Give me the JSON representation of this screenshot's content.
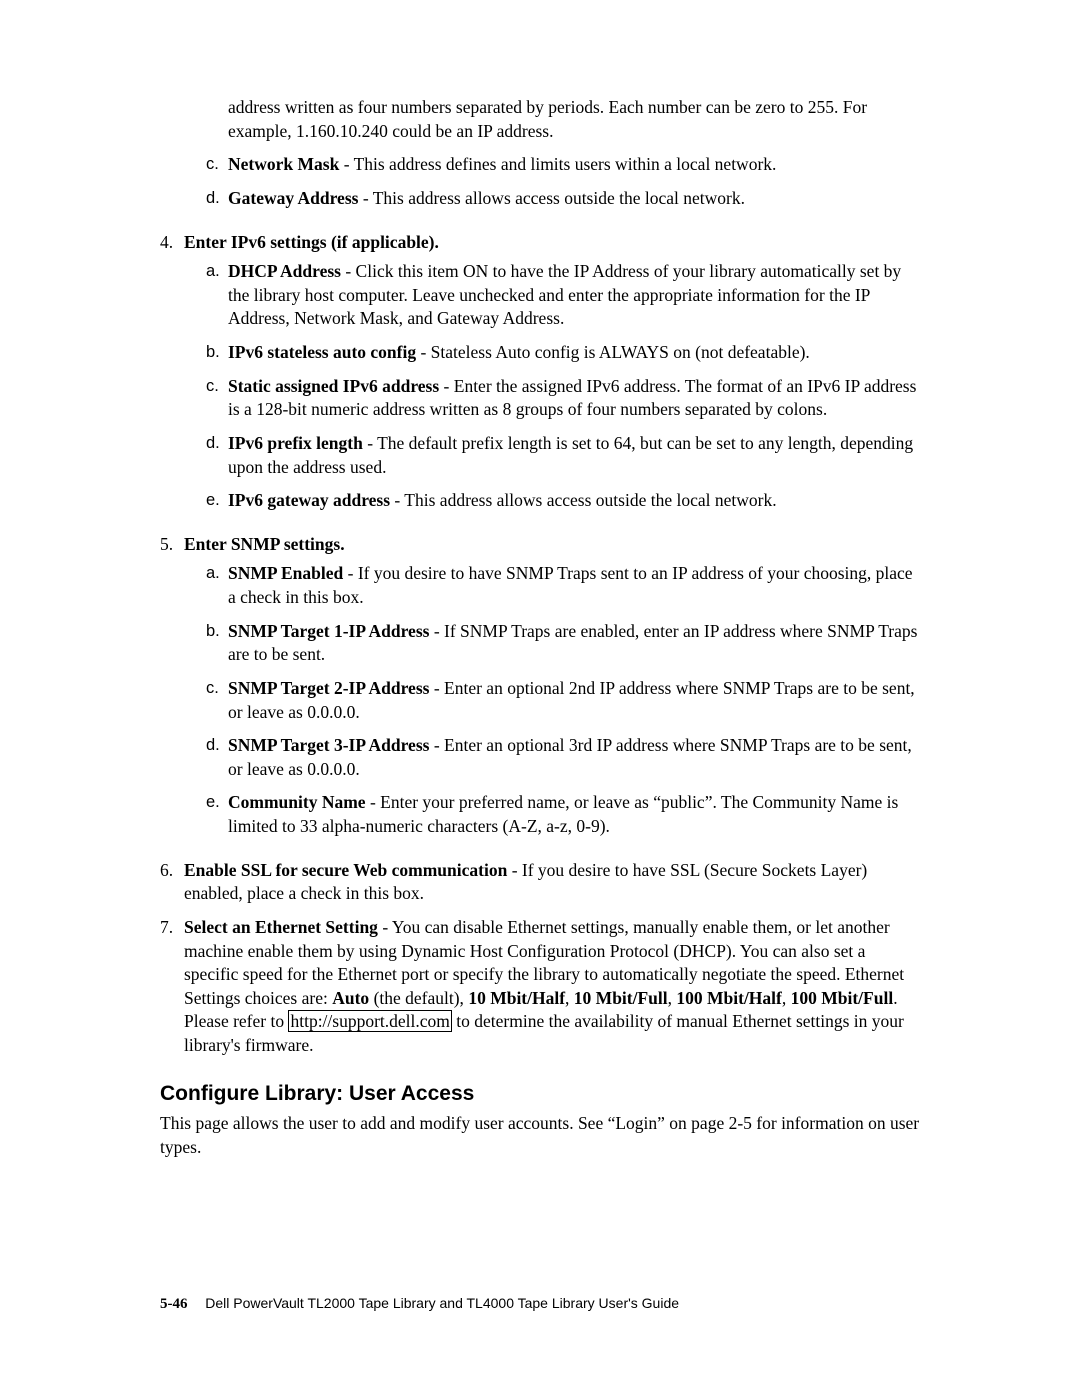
{
  "intro_continuation": {
    "text_prefix": "address written as four numbers separated by periods. Each number can be zero to 255. For example, 1.160.10.240 could be an IP address."
  },
  "items_top": [
    {
      "marker": "c.",
      "label": "Network Mask",
      "text": " - This address defines and limits users within a local network."
    },
    {
      "marker": "d.",
      "label": "Gateway Address",
      "text": " - This address allows access outside the local network."
    }
  ],
  "step4": {
    "marker": "4.",
    "heading": "Enter IPv6 settings (if applicable).",
    "subs": [
      {
        "marker": "a.",
        "label": "DHCP Address",
        "text": " - Click this item ON to have the IP Address of your library automatically set by the library host computer. Leave unchecked and enter the appropriate information for the IP Address, Network Mask, and Gateway Address."
      },
      {
        "marker": "b.",
        "label": "IPv6 stateless auto config",
        "text": " - Stateless Auto config is ALWAYS on (not defeatable)."
      },
      {
        "marker": "c.",
        "label": "Static assigned IPv6 address",
        "text": " - Enter the assigned IPv6 address. The format of an IPv6 IP address is a 128-bit numeric address written as 8 groups of four numbers separated by colons."
      },
      {
        "marker": "d.",
        "label": "IPv6 prefix length",
        "text": " - The default prefix length is set to 64, but can be set to any length, depending upon the address used."
      },
      {
        "marker": "e.",
        "label": "IPv6 gateway address",
        "text": " - This address allows access outside the local network."
      }
    ]
  },
  "step5": {
    "marker": "5.",
    "heading": "Enter SNMP settings.",
    "subs": [
      {
        "marker": "a.",
        "label": "SNMP Enabled",
        "text": " - If you desire to have SNMP Traps sent to an IP address of your choosing, place a check in this box."
      },
      {
        "marker": "b.",
        "label": "SNMP Target 1-IP Address",
        "text": " - If SNMP Traps are enabled, enter an IP address where SNMP Traps are to be sent."
      },
      {
        "marker": "c.",
        "label": "SNMP Target 2-IP Address",
        "text": " - Enter an optional 2nd IP address where SNMP Traps are to be sent, or leave as 0.0.0.0."
      },
      {
        "marker": "d.",
        "label": "SNMP Target 3-IP Address",
        "text": " - Enter an optional 3rd IP address where SNMP Traps are to be sent, or leave as 0.0.0.0."
      },
      {
        "marker": "e.",
        "label": "Community Name",
        "text": " - Enter your preferred name, or leave as “public”. The Community Name is limited to 33 alpha-numeric characters (A-Z, a-z, 0-9)."
      }
    ]
  },
  "step6": {
    "marker": "6.",
    "label": "Enable SSL for secure Web communication",
    "text": " - If you desire to have SSL (Secure Sockets Layer) enabled, place a check in this box."
  },
  "step7": {
    "marker": "7.",
    "label": "Select an Ethernet Setting",
    "text_before_settings": " - You can disable Ethernet settings, manually enable them, or let another machine enable them by using Dynamic Host Configuration Protocol (DHCP). You can also set a specific speed for the Ethernet port or specify the library to automatically negotiate the speed. Ethernet Settings choices are: ",
    "opt1": "Auto",
    "after1": " (the default), ",
    "opt2": "10 Mbit/Half",
    "sep2": ", ",
    "opt3": "10 Mbit/Full",
    "sep3": ", ",
    "opt4": "100 Mbit/Half",
    "sep4": ", ",
    "opt5": "100 Mbit/Full",
    "after5": ". Please refer to ",
    "link_text": "http://support.dell.com",
    "text_after_link": " to determine the availability of manual Ethernet settings in your library's firmware."
  },
  "section": {
    "heading": "Configure Library: User Access",
    "body": "This page allows the user to add and modify user accounts. See “Login” on page 2-5 for information on user types."
  },
  "footer": {
    "page": "5-46",
    "guide": "Dell PowerVault TL2000 Tape Library and TL4000 Tape Library User's Guide"
  }
}
